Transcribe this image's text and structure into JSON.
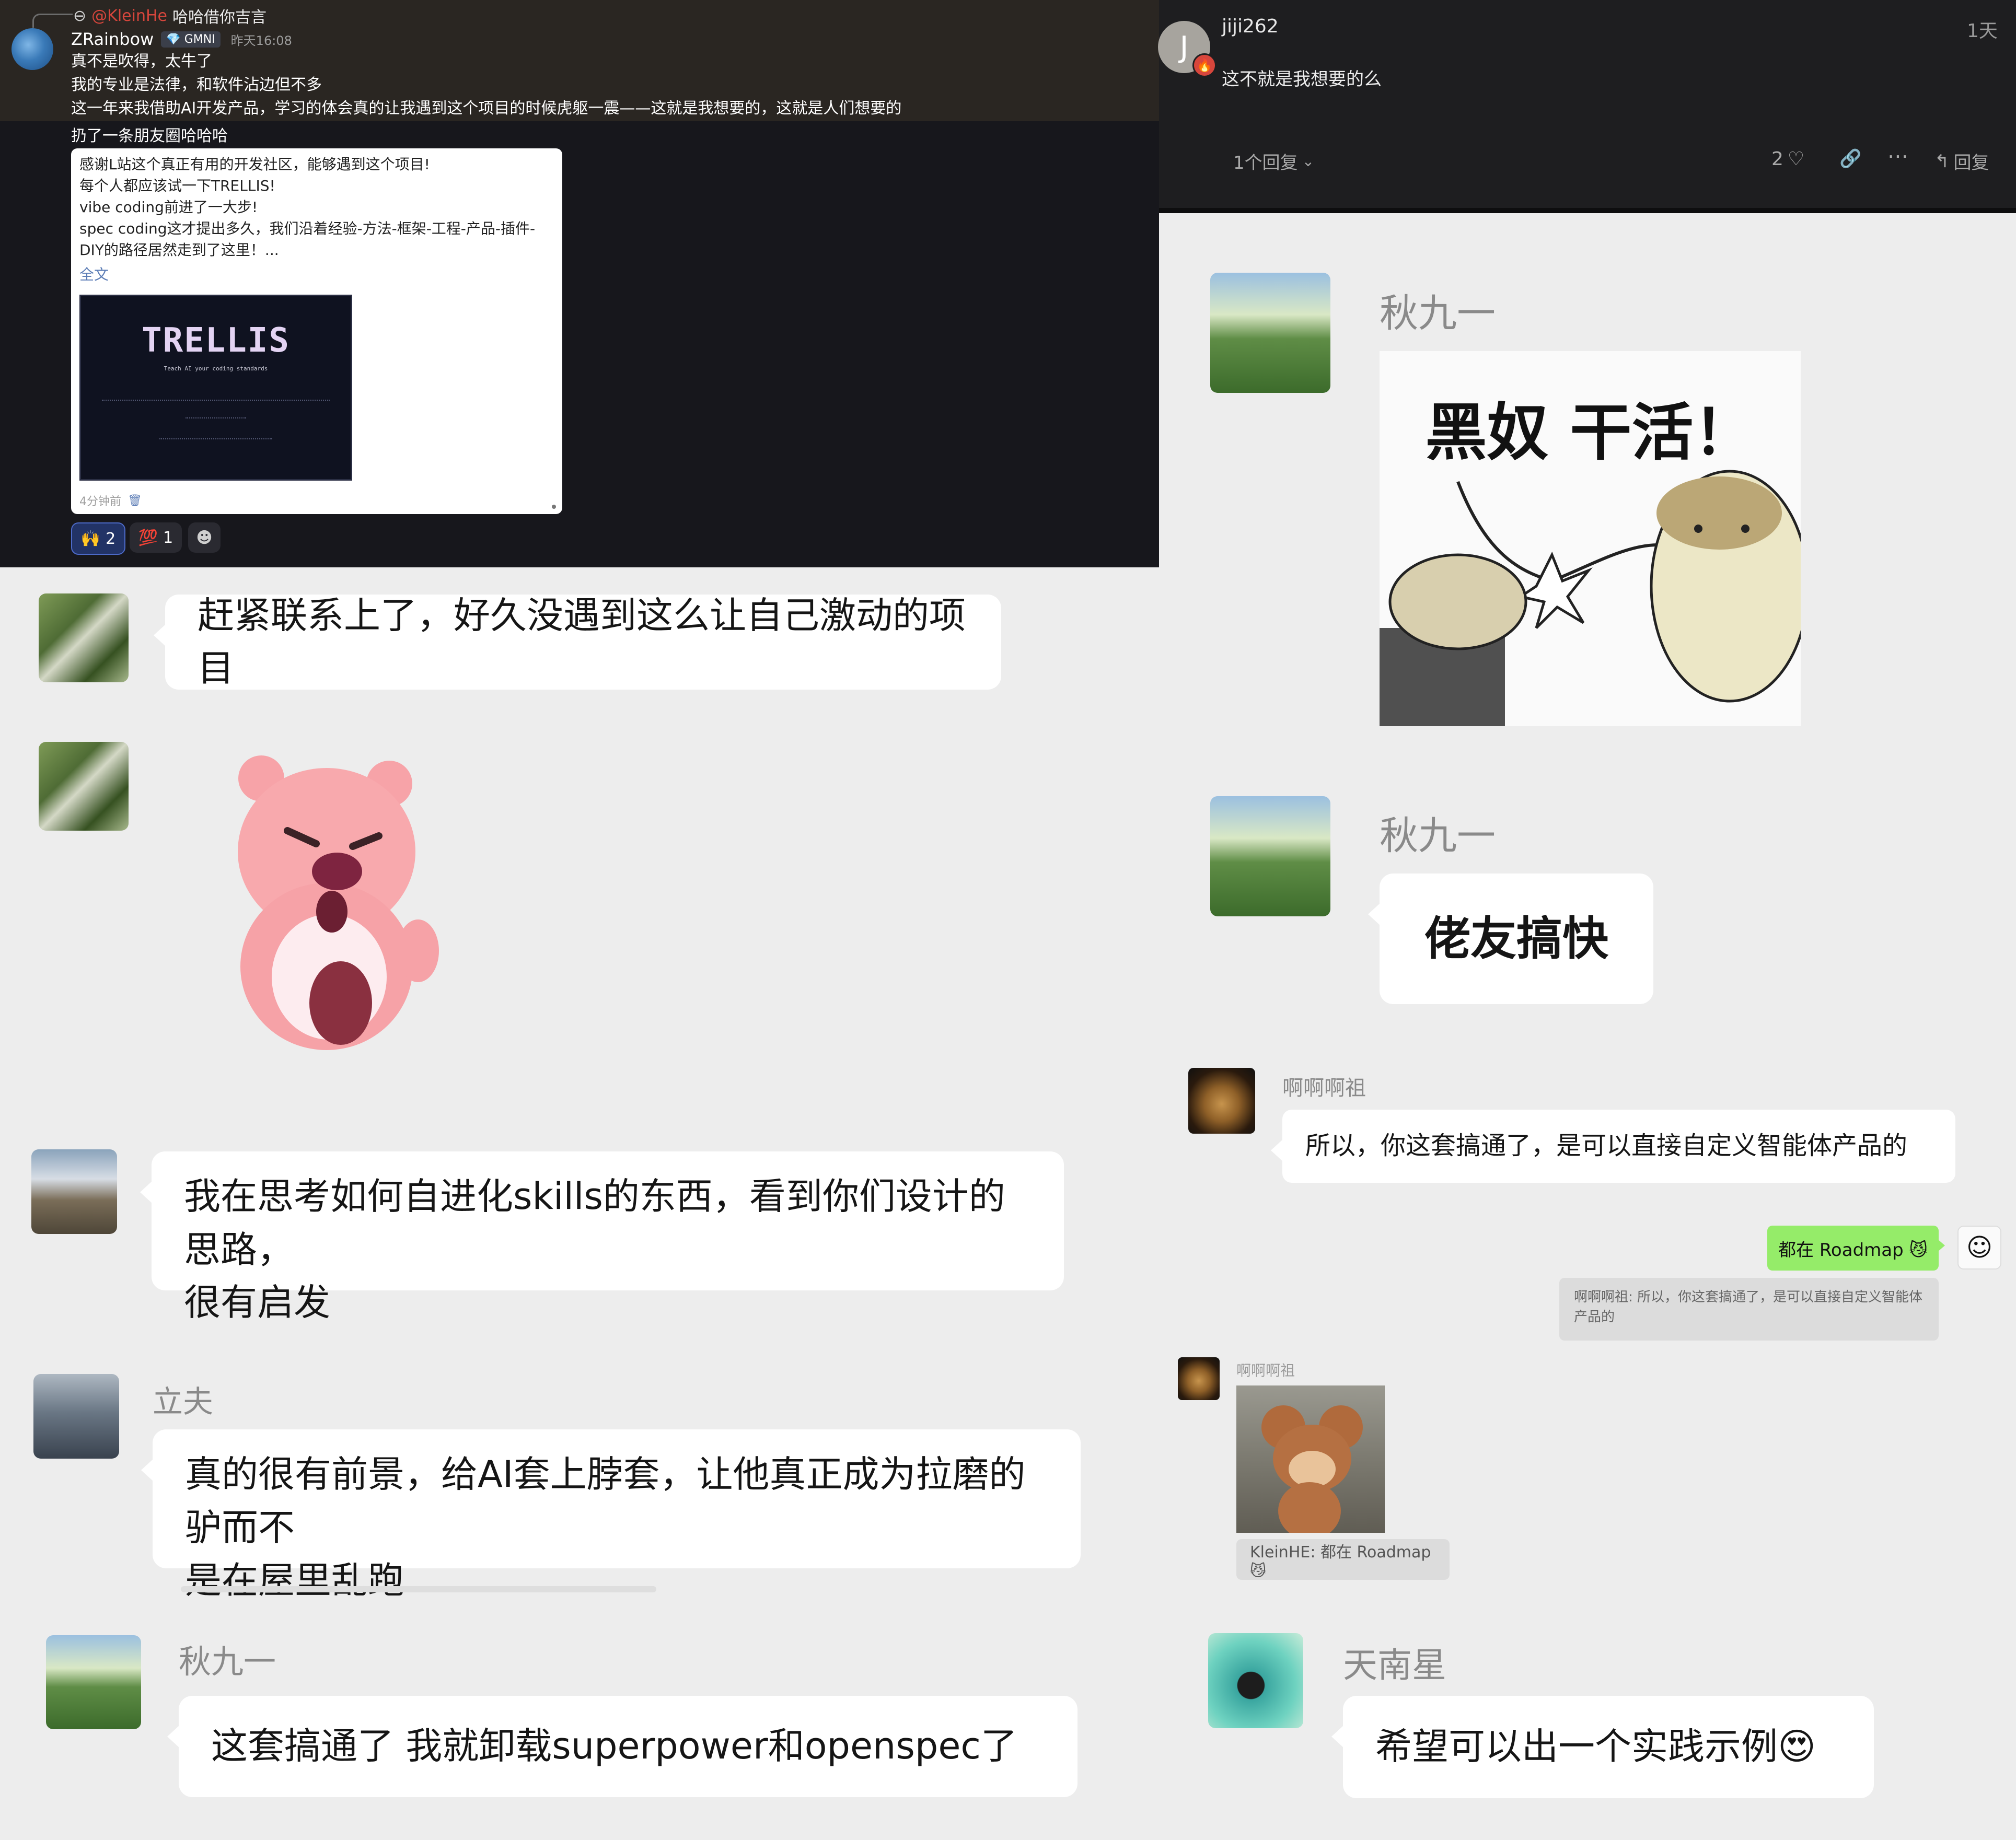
{
  "top_left_post": {
    "reply_to_user": "@KleinHe",
    "reply_to_text": "哈哈借你吉言",
    "author": "ZRainbow",
    "badge": "GMNI",
    "time": "昨天16:08",
    "lines": [
      "真不是吹得，太牛了",
      "我的专业是法律，和软件沾边但不多",
      "这一年来我借助AI开发产品，学习的体会真的让我遇到这个项目的时候虎躯一震——这就是我想要的，这就是人们想要的",
      "扔了一条朋友圈哈哈哈"
    ],
    "share_card": {
      "lines": [
        "感谢L站这个真正有用的开发社区，能够遇到这个项目!",
        "每个人都应该试一下TRELLIS!",
        "vibe coding前进了一大步!",
        "spec coding这才提出多久，我们沿着经验-方法-框架-工程-产品-插件-",
        "DIY的路径居然走到了这里！..."
      ],
      "full_text_link": "全文",
      "image_title": "TRELLIS",
      "image_subtitle": "Teach AI your coding standards",
      "time": "4分钟前"
    },
    "reactions": [
      {
        "emoji": "🙌",
        "count": "2"
      },
      {
        "emoji": "💯",
        "count": "1"
      }
    ]
  },
  "top_right_post": {
    "avatar_letter": "J",
    "author": "jiji262",
    "time": "1天",
    "content": "这不就是我想要的么",
    "replies_label": "1个回复",
    "likes": "2",
    "reply_button": "回复"
  },
  "left_chat": [
    {
      "text": "赶紧联系上了，好久没遇到这么让自己激动的项目"
    },
    {
      "text": "我在思考如何自进化skills的东西，看到你们设计的思路，",
      "text2": "很有启发"
    },
    {
      "name": "立夫",
      "text": "真的很有前景，给AI套上脖套，让他真正成为拉磨的驴而不",
      "text2": "是在屋里乱跑"
    },
    {
      "name": "秋九一",
      "text": "这套搞通了 我就卸载superpower和openspec了"
    }
  ],
  "right_chat": {
    "msg1_name": "秋九一",
    "sticker_text": "黑奴 干活！",
    "msg2_name": "秋九一",
    "msg2_text": "佬友搞快",
    "msg3_name": "啊啊啊祖",
    "msg3_text": "所以，你这套搞通了，是可以直接自定义智能体产品的",
    "self_reply": "都在 Roadmap 😼",
    "quote_text": "啊啊啊祖: 所以，你这套搞通了，是可以直接自定义智能体产品的",
    "msg4_name": "啊啊啊祖",
    "msg4_quote": "KleinHE: 都在 Roadmap 😼",
    "msg5_name": "天南星",
    "msg5_text": "希望可以出一个实践示例😍"
  },
  "colors": {
    "chat_bg": "#ededed",
    "dark_panel": "#17171c",
    "self_bubble": "#95ec69",
    "accent_red": "#d7463c"
  }
}
